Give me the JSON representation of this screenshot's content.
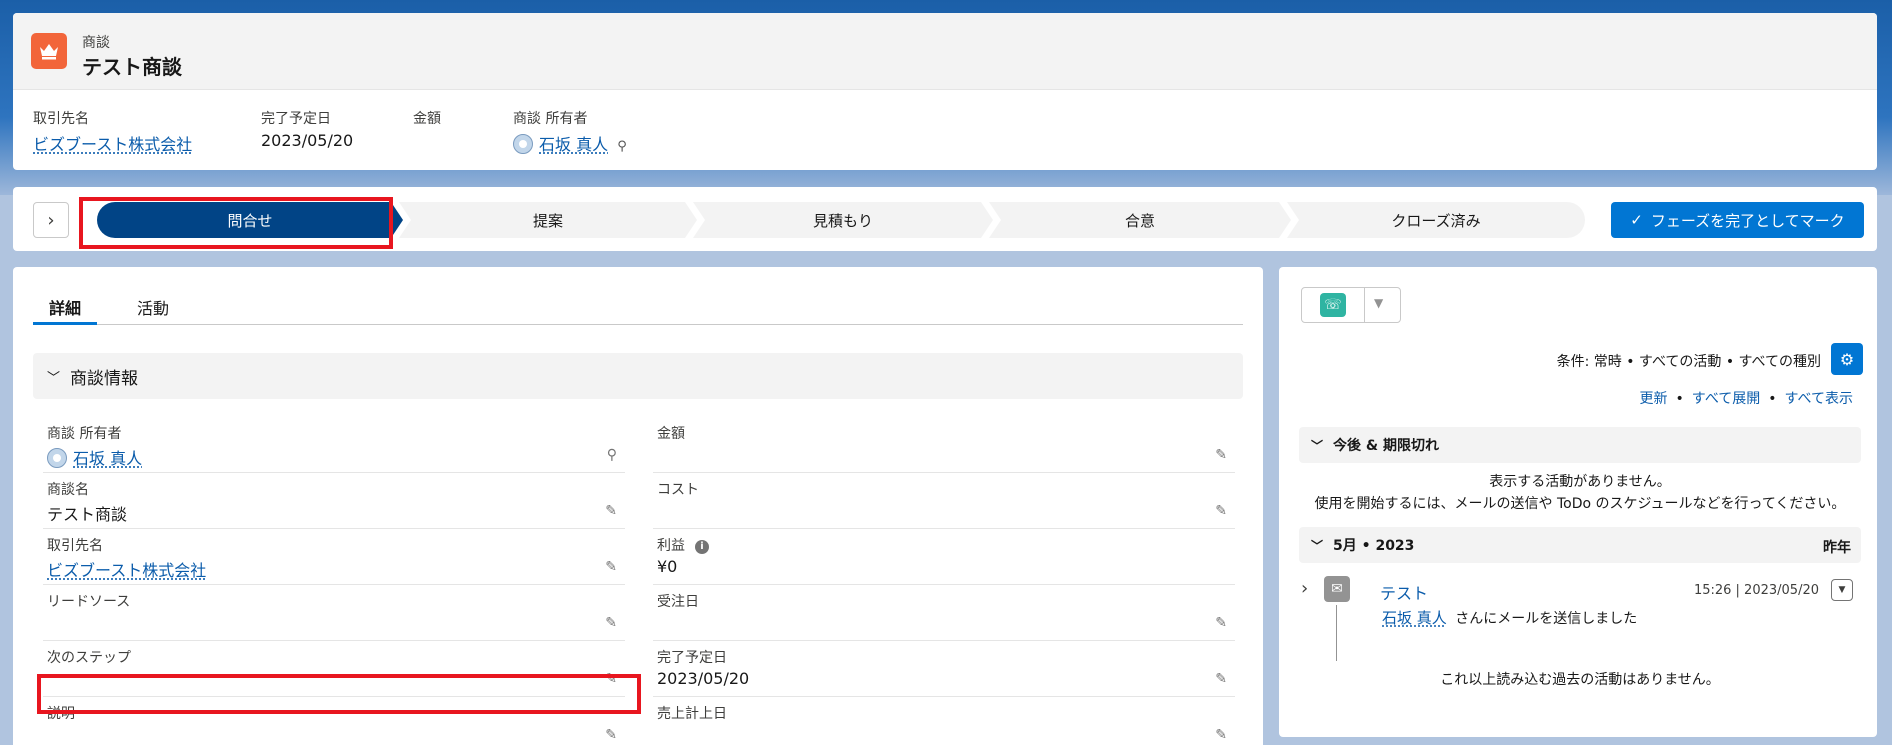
{
  "record": {
    "object_type": "商談",
    "title": "テスト商談",
    "header_fields": [
      {
        "label": "取引先名",
        "value": "ビズブースト株式会社"
      },
      {
        "label": "完了予定日",
        "value": "2023/05/20"
      },
      {
        "label": "金額",
        "value": ""
      },
      {
        "label": "商談 所有者",
        "value": "石坂 真人"
      }
    ]
  },
  "path": {
    "stages": [
      "問合せ",
      "提案",
      "見積もり",
      "合意",
      "クローズ済み"
    ],
    "active_stage": "問合せ",
    "mark_complete_label": "フェーズを完了としてマーク"
  },
  "detail": {
    "tabs": [
      "詳細",
      "活動"
    ],
    "active_tab": "詳細",
    "section_title": "商談情報",
    "left_fields": [
      {
        "label": "商談 所有者",
        "value": "石坂 真人"
      },
      {
        "label": "商談名",
        "value": "テスト商談"
      },
      {
        "label": "取引先名",
        "value": "ビズブースト株式会社"
      },
      {
        "label": "リードソース",
        "value": ""
      },
      {
        "label": "次のステップ",
        "value": ""
      },
      {
        "label": "説明",
        "value": ""
      }
    ],
    "right_fields": [
      {
        "label": "金額",
        "value": ""
      },
      {
        "label": "コスト",
        "value": ""
      },
      {
        "label": "利益",
        "value": "¥0"
      },
      {
        "label": "受注日",
        "value": ""
      },
      {
        "label": "完了予定日",
        "value": "2023/05/20"
      },
      {
        "label": "売上計上日",
        "value": ""
      }
    ]
  },
  "activity": {
    "filter_text": "条件: 常時 • すべての活動 • すべての種別",
    "links": [
      "更新",
      "すべて展開",
      "すべて表示"
    ],
    "upcoming_title": "今後 & 期限切れ",
    "no_activity_line1": "表示する活動がありません。",
    "no_activity_line2": "使用を開始するには、メールの送信や ToDo のスケジュールなどを行ってください。",
    "month_title": "5月 • 2023",
    "month_right": "昨年",
    "item": {
      "title": "テスト",
      "time": "15:26 | 2023/05/20",
      "user": "石坂 真人",
      "description": "さんにメールを送信しました"
    },
    "no_more": "これ以上読み込む過去の活動はありません。"
  },
  "colors": {
    "brand": "#0176d3",
    "path_active": "#014486",
    "highlight": "#e8161f",
    "object_icon": "#f2653a"
  }
}
